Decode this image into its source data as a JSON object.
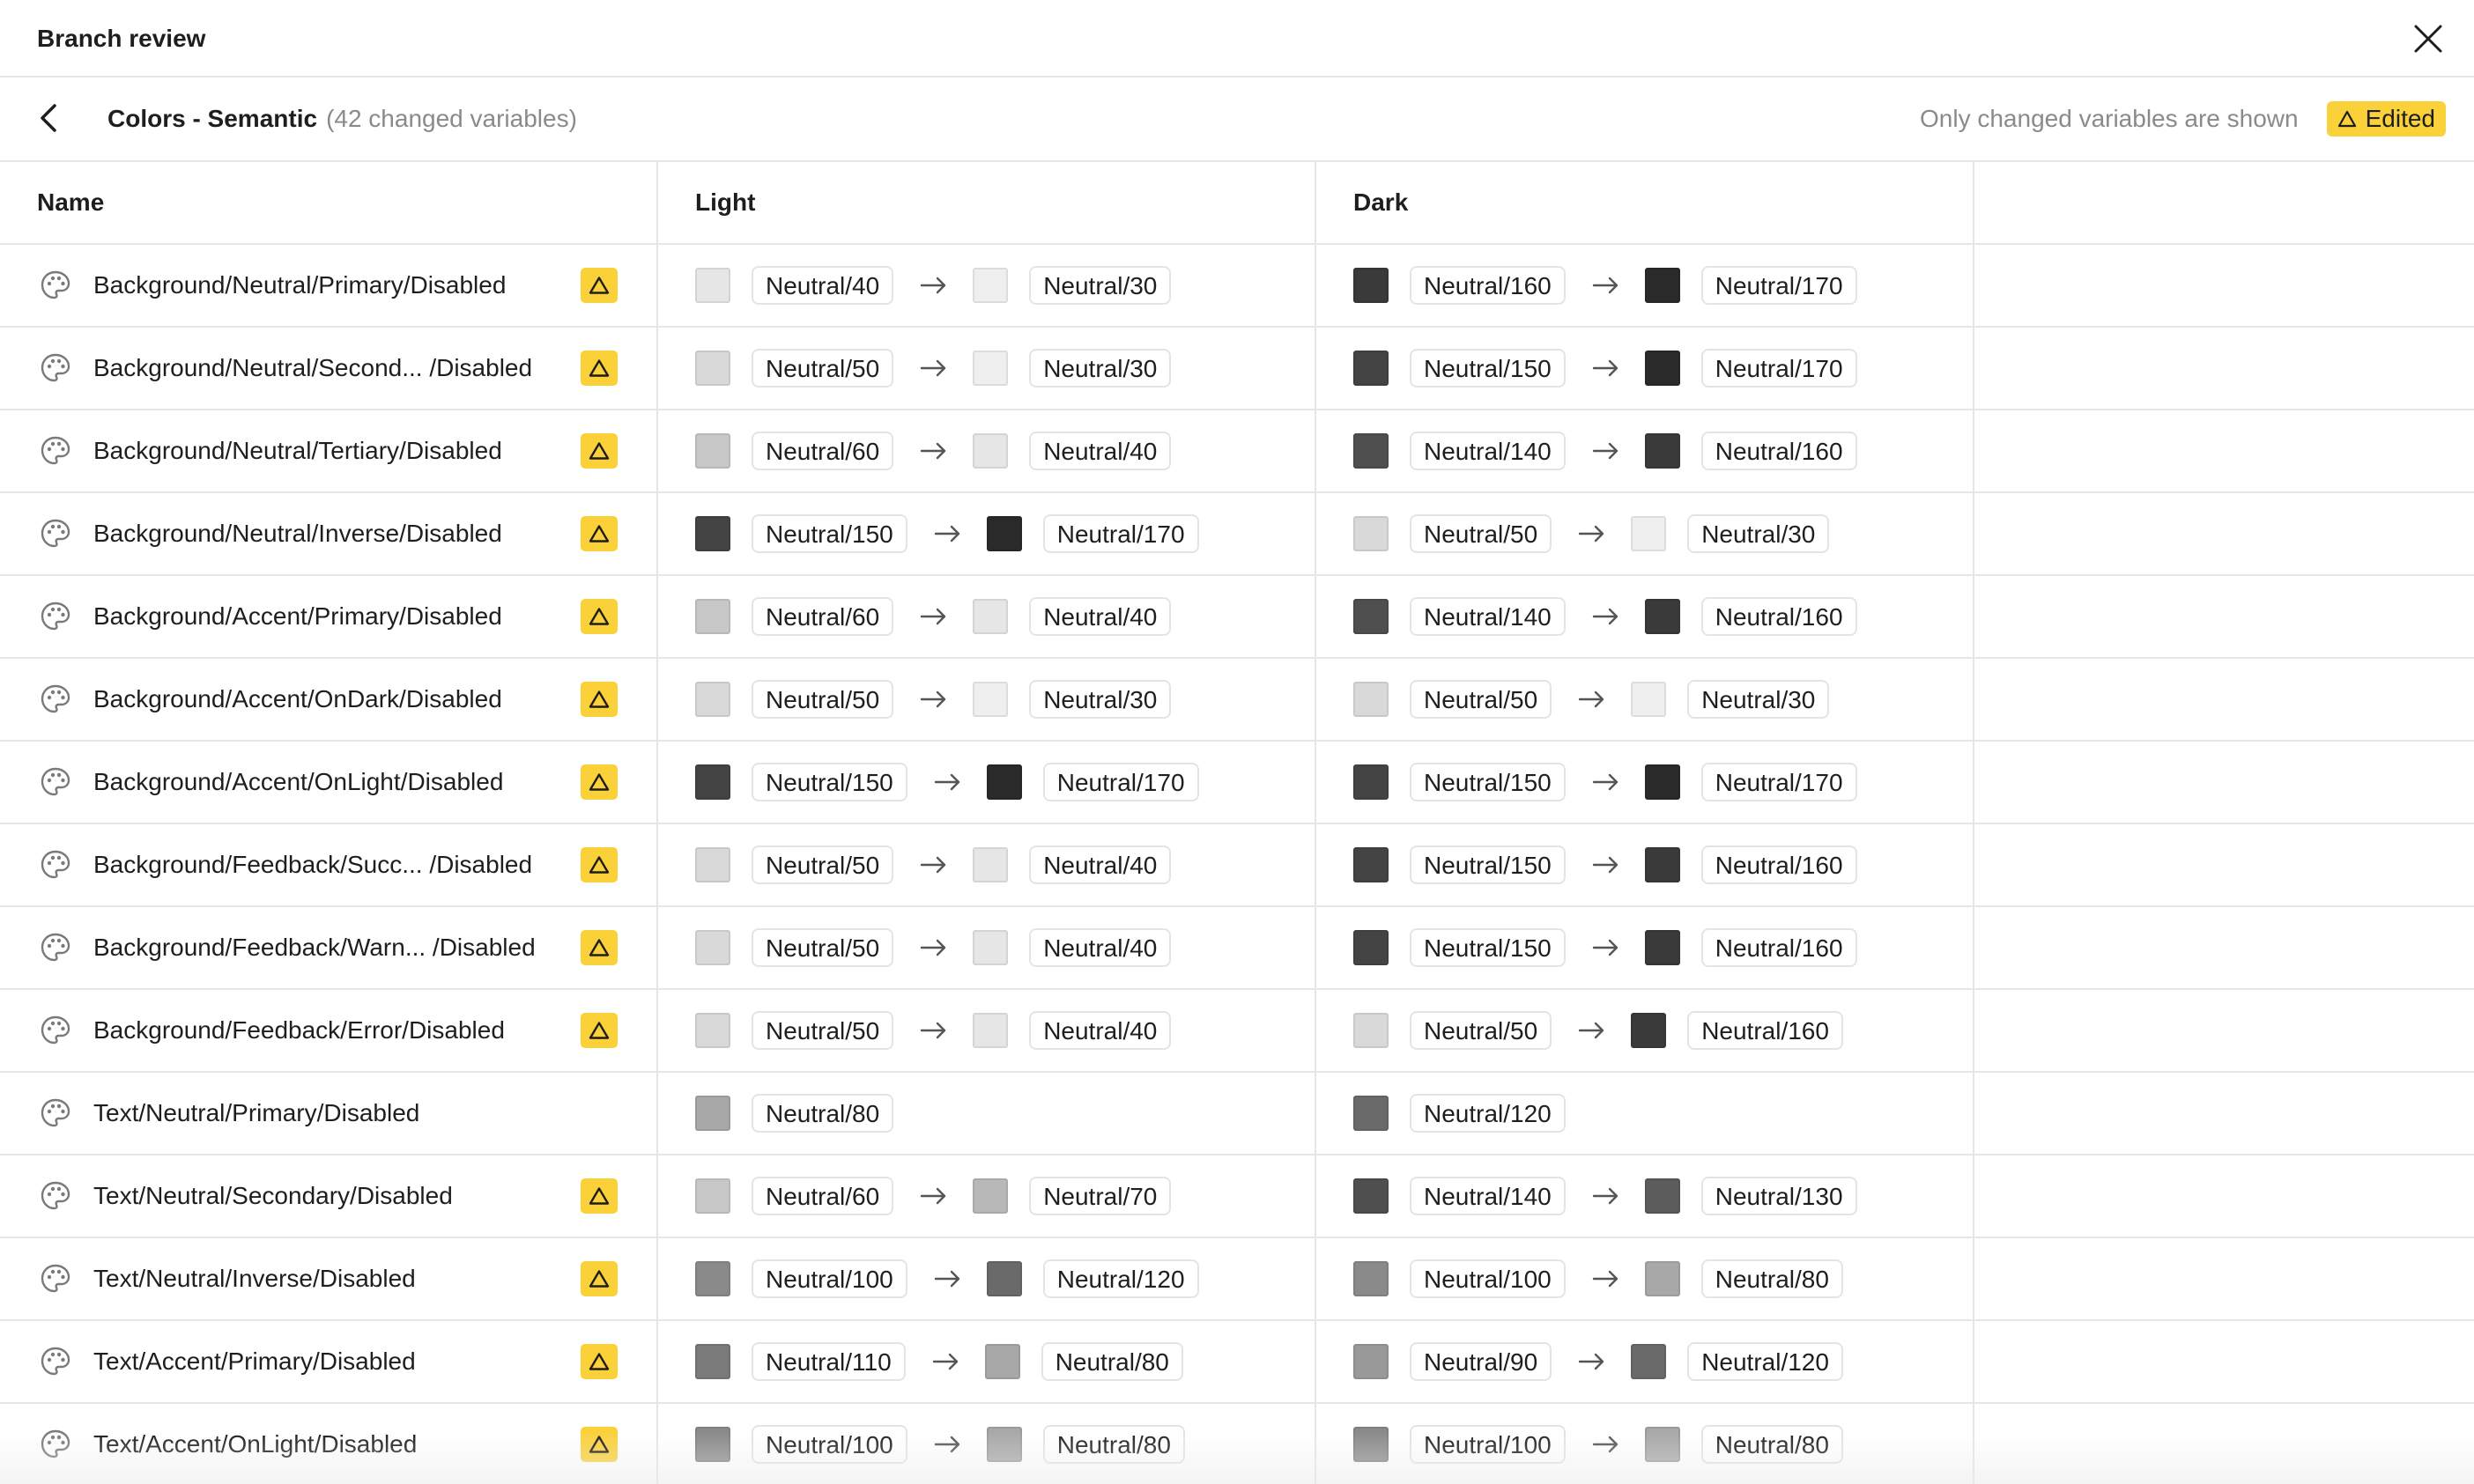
{
  "window": {
    "title": "Branch review"
  },
  "subheader": {
    "collection": "Colors - Semantic",
    "count": "(42 changed variables)",
    "note": "Only changed variables are shown",
    "badge": "Edited"
  },
  "table": {
    "headers": {
      "name": "Name",
      "light": "Light",
      "dark": "Dark"
    },
    "rows": [
      {
        "name": "Background/Neutral/Primary/Disabled",
        "warning": true,
        "light": {
          "from": {
            "label": "Neutral/40",
            "color": "#e6e6e6"
          },
          "to": {
            "label": "Neutral/30",
            "color": "#efefef"
          }
        },
        "dark": {
          "from": {
            "label": "Neutral/160",
            "color": "#3a3a3a"
          },
          "to": {
            "label": "Neutral/170",
            "color": "#2a2a2a"
          }
        }
      },
      {
        "name": "Background/Neutral/Second... /Disabled",
        "warning": true,
        "light": {
          "from": {
            "label": "Neutral/50",
            "color": "#d9d9d9"
          },
          "to": {
            "label": "Neutral/30",
            "color": "#efefef"
          }
        },
        "dark": {
          "from": {
            "label": "Neutral/150",
            "color": "#444444"
          },
          "to": {
            "label": "Neutral/170",
            "color": "#2a2a2a"
          }
        }
      },
      {
        "name": "Background/Neutral/Tertiary/Disabled",
        "warning": true,
        "light": {
          "from": {
            "label": "Neutral/60",
            "color": "#c8c8c8"
          },
          "to": {
            "label": "Neutral/40",
            "color": "#e6e6e6"
          }
        },
        "dark": {
          "from": {
            "label": "Neutral/140",
            "color": "#4f4f4f"
          },
          "to": {
            "label": "Neutral/160",
            "color": "#3a3a3a"
          }
        }
      },
      {
        "name": "Background/Neutral/Inverse/Disabled",
        "warning": true,
        "light": {
          "from": {
            "label": "Neutral/150",
            "color": "#444444"
          },
          "to": {
            "label": "Neutral/170",
            "color": "#2a2a2a"
          }
        },
        "dark": {
          "from": {
            "label": "Neutral/50",
            "color": "#d9d9d9"
          },
          "to": {
            "label": "Neutral/30",
            "color": "#efefef"
          }
        }
      },
      {
        "name": "Background/Accent/Primary/Disabled",
        "warning": true,
        "light": {
          "from": {
            "label": "Neutral/60",
            "color": "#c8c8c8"
          },
          "to": {
            "label": "Neutral/40",
            "color": "#e6e6e6"
          }
        },
        "dark": {
          "from": {
            "label": "Neutral/140",
            "color": "#4f4f4f"
          },
          "to": {
            "label": "Neutral/160",
            "color": "#3a3a3a"
          }
        }
      },
      {
        "name": "Background/Accent/OnDark/Disabled",
        "warning": true,
        "light": {
          "from": {
            "label": "Neutral/50",
            "color": "#d9d9d9"
          },
          "to": {
            "label": "Neutral/30",
            "color": "#efefef"
          }
        },
        "dark": {
          "from": {
            "label": "Neutral/50",
            "color": "#d9d9d9"
          },
          "to": {
            "label": "Neutral/30",
            "color": "#efefef"
          }
        }
      },
      {
        "name": "Background/Accent/OnLight/Disabled",
        "warning": true,
        "light": {
          "from": {
            "label": "Neutral/150",
            "color": "#444444"
          },
          "to": {
            "label": "Neutral/170",
            "color": "#2a2a2a"
          }
        },
        "dark": {
          "from": {
            "label": "Neutral/150",
            "color": "#444444"
          },
          "to": {
            "label": "Neutral/170",
            "color": "#2a2a2a"
          }
        }
      },
      {
        "name": "Background/Feedback/Succ... /Disabled",
        "warning": true,
        "light": {
          "from": {
            "label": "Neutral/50",
            "color": "#d9d9d9"
          },
          "to": {
            "label": "Neutral/40",
            "color": "#e6e6e6"
          }
        },
        "dark": {
          "from": {
            "label": "Neutral/150",
            "color": "#444444"
          },
          "to": {
            "label": "Neutral/160",
            "color": "#3a3a3a"
          }
        }
      },
      {
        "name": "Background/Feedback/Warn... /Disabled",
        "warning": true,
        "light": {
          "from": {
            "label": "Neutral/50",
            "color": "#d9d9d9"
          },
          "to": {
            "label": "Neutral/40",
            "color": "#e6e6e6"
          }
        },
        "dark": {
          "from": {
            "label": "Neutral/150",
            "color": "#444444"
          },
          "to": {
            "label": "Neutral/160",
            "color": "#3a3a3a"
          }
        }
      },
      {
        "name": "Background/Feedback/Error/Disabled",
        "warning": true,
        "light": {
          "from": {
            "label": "Neutral/50",
            "color": "#d9d9d9"
          },
          "to": {
            "label": "Neutral/40",
            "color": "#e6e6e6"
          }
        },
        "dark": {
          "from": {
            "label": "Neutral/50",
            "color": "#d9d9d9"
          },
          "to": {
            "label": "Neutral/160",
            "color": "#3a3a3a"
          }
        }
      },
      {
        "name": "Text/Neutral/Primary/Disabled",
        "warning": false,
        "light": {
          "from": {
            "label": "Neutral/80",
            "color": "#a8a8a8"
          }
        },
        "dark": {
          "from": {
            "label": "Neutral/120",
            "color": "#6a6a6a"
          }
        }
      },
      {
        "name": "Text/Neutral/Secondary/Disabled",
        "warning": true,
        "light": {
          "from": {
            "label": "Neutral/60",
            "color": "#c8c8c8"
          },
          "to": {
            "label": "Neutral/70",
            "color": "#b8b8b8"
          }
        },
        "dark": {
          "from": {
            "label": "Neutral/140",
            "color": "#4f4f4f"
          },
          "to": {
            "label": "Neutral/130",
            "color": "#5c5c5c"
          }
        }
      },
      {
        "name": "Text/Neutral/Inverse/Disabled",
        "warning": true,
        "light": {
          "from": {
            "label": "Neutral/100",
            "color": "#8a8a8a"
          },
          "to": {
            "label": "Neutral/120",
            "color": "#6a6a6a"
          }
        },
        "dark": {
          "from": {
            "label": "Neutral/100",
            "color": "#8a8a8a"
          },
          "to": {
            "label": "Neutral/80",
            "color": "#a8a8a8"
          }
        }
      },
      {
        "name": "Text/Accent/Primary/Disabled",
        "warning": true,
        "light": {
          "from": {
            "label": "Neutral/110",
            "color": "#7a7a7a"
          },
          "to": {
            "label": "Neutral/80",
            "color": "#a8a8a8"
          }
        },
        "dark": {
          "from": {
            "label": "Neutral/90",
            "color": "#999999"
          },
          "to": {
            "label": "Neutral/120",
            "color": "#6a6a6a"
          }
        }
      },
      {
        "name": "Text/Accent/OnLight/Disabled",
        "warning": true,
        "light": {
          "from": {
            "label": "Neutral/100",
            "color": "#8a8a8a"
          },
          "to": {
            "label": "Neutral/80",
            "color": "#a8a8a8"
          }
        },
        "dark": {
          "from": {
            "label": "Neutral/100",
            "color": "#8a8a8a"
          },
          "to": {
            "label": "Neutral/80",
            "color": "#a8a8a8"
          }
        }
      }
    ]
  },
  "icons": {
    "close": "close-icon",
    "back": "chevron-left-icon",
    "variable": "palette-icon",
    "warning": "warning-triangle-icon",
    "arrow": "arrow-right-icon"
  },
  "colors": {
    "accent": "#fbd13a",
    "border": "#e6e6e6",
    "muted_text": "#8a8a8a"
  }
}
